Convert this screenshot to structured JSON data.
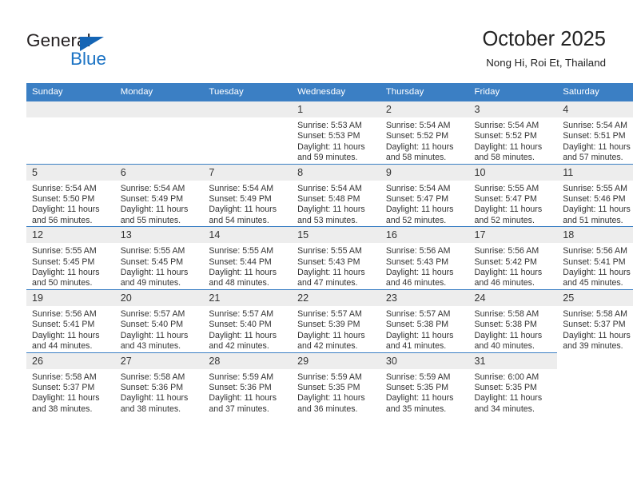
{
  "brand": {
    "name_dark": "General",
    "name_blue": "Blue",
    "triangle_color": "#1565b5",
    "blue_color": "#1b73c4"
  },
  "header": {
    "title": "October 2025",
    "subtitle": "Nong Hi, Roi Et, Thailand"
  },
  "theme": {
    "header_blue": "#3b7fc4",
    "daynum_bg": "#ededed",
    "text": "#333333"
  },
  "calendar": {
    "weekday_headers": [
      "Sunday",
      "Monday",
      "Tuesday",
      "Wednesday",
      "Thursday",
      "Friday",
      "Saturday"
    ],
    "weeks": [
      [
        {
          "day": "",
          "lines": []
        },
        {
          "day": "",
          "lines": []
        },
        {
          "day": "",
          "lines": []
        },
        {
          "day": "1",
          "lines": [
            "Sunrise: 5:53 AM",
            "Sunset: 5:53 PM",
            "Daylight: 11 hours and 59 minutes."
          ]
        },
        {
          "day": "2",
          "lines": [
            "Sunrise: 5:54 AM",
            "Sunset: 5:52 PM",
            "Daylight: 11 hours and 58 minutes."
          ]
        },
        {
          "day": "3",
          "lines": [
            "Sunrise: 5:54 AM",
            "Sunset: 5:52 PM",
            "Daylight: 11 hours and 58 minutes."
          ]
        },
        {
          "day": "4",
          "lines": [
            "Sunrise: 5:54 AM",
            "Sunset: 5:51 PM",
            "Daylight: 11 hours and 57 minutes."
          ]
        }
      ],
      [
        {
          "day": "5",
          "lines": [
            "Sunrise: 5:54 AM",
            "Sunset: 5:50 PM",
            "Daylight: 11 hours and 56 minutes."
          ]
        },
        {
          "day": "6",
          "lines": [
            "Sunrise: 5:54 AM",
            "Sunset: 5:49 PM",
            "Daylight: 11 hours and 55 minutes."
          ]
        },
        {
          "day": "7",
          "lines": [
            "Sunrise: 5:54 AM",
            "Sunset: 5:49 PM",
            "Daylight: 11 hours and 54 minutes."
          ]
        },
        {
          "day": "8",
          "lines": [
            "Sunrise: 5:54 AM",
            "Sunset: 5:48 PM",
            "Daylight: 11 hours and 53 minutes."
          ]
        },
        {
          "day": "9",
          "lines": [
            "Sunrise: 5:54 AM",
            "Sunset: 5:47 PM",
            "Daylight: 11 hours and 52 minutes."
          ]
        },
        {
          "day": "10",
          "lines": [
            "Sunrise: 5:55 AM",
            "Sunset: 5:47 PM",
            "Daylight: 11 hours and 52 minutes."
          ]
        },
        {
          "day": "11",
          "lines": [
            "Sunrise: 5:55 AM",
            "Sunset: 5:46 PM",
            "Daylight: 11 hours and 51 minutes."
          ]
        }
      ],
      [
        {
          "day": "12",
          "lines": [
            "Sunrise: 5:55 AM",
            "Sunset: 5:45 PM",
            "Daylight: 11 hours and 50 minutes."
          ]
        },
        {
          "day": "13",
          "lines": [
            "Sunrise: 5:55 AM",
            "Sunset: 5:45 PM",
            "Daylight: 11 hours and 49 minutes."
          ]
        },
        {
          "day": "14",
          "lines": [
            "Sunrise: 5:55 AM",
            "Sunset: 5:44 PM",
            "Daylight: 11 hours and 48 minutes."
          ]
        },
        {
          "day": "15",
          "lines": [
            "Sunrise: 5:55 AM",
            "Sunset: 5:43 PM",
            "Daylight: 11 hours and 47 minutes."
          ]
        },
        {
          "day": "16",
          "lines": [
            "Sunrise: 5:56 AM",
            "Sunset: 5:43 PM",
            "Daylight: 11 hours and 46 minutes."
          ]
        },
        {
          "day": "17",
          "lines": [
            "Sunrise: 5:56 AM",
            "Sunset: 5:42 PM",
            "Daylight: 11 hours and 46 minutes."
          ]
        },
        {
          "day": "18",
          "lines": [
            "Sunrise: 5:56 AM",
            "Sunset: 5:41 PM",
            "Daylight: 11 hours and 45 minutes."
          ]
        }
      ],
      [
        {
          "day": "19",
          "lines": [
            "Sunrise: 5:56 AM",
            "Sunset: 5:41 PM",
            "Daylight: 11 hours and 44 minutes."
          ]
        },
        {
          "day": "20",
          "lines": [
            "Sunrise: 5:57 AM",
            "Sunset: 5:40 PM",
            "Daylight: 11 hours and 43 minutes."
          ]
        },
        {
          "day": "21",
          "lines": [
            "Sunrise: 5:57 AM",
            "Sunset: 5:40 PM",
            "Daylight: 11 hours and 42 minutes."
          ]
        },
        {
          "day": "22",
          "lines": [
            "Sunrise: 5:57 AM",
            "Sunset: 5:39 PM",
            "Daylight: 11 hours and 42 minutes."
          ]
        },
        {
          "day": "23",
          "lines": [
            "Sunrise: 5:57 AM",
            "Sunset: 5:38 PM",
            "Daylight: 11 hours and 41 minutes."
          ]
        },
        {
          "day": "24",
          "lines": [
            "Sunrise: 5:58 AM",
            "Sunset: 5:38 PM",
            "Daylight: 11 hours and 40 minutes."
          ]
        },
        {
          "day": "25",
          "lines": [
            "Sunrise: 5:58 AM",
            "Sunset: 5:37 PM",
            "Daylight: 11 hours and 39 minutes."
          ]
        }
      ],
      [
        {
          "day": "26",
          "lines": [
            "Sunrise: 5:58 AM",
            "Sunset: 5:37 PM",
            "Daylight: 11 hours and 38 minutes."
          ]
        },
        {
          "day": "27",
          "lines": [
            "Sunrise: 5:58 AM",
            "Sunset: 5:36 PM",
            "Daylight: 11 hours and 38 minutes."
          ]
        },
        {
          "day": "28",
          "lines": [
            "Sunrise: 5:59 AM",
            "Sunset: 5:36 PM",
            "Daylight: 11 hours and 37 minutes."
          ]
        },
        {
          "day": "29",
          "lines": [
            "Sunrise: 5:59 AM",
            "Sunset: 5:35 PM",
            "Daylight: 11 hours and 36 minutes."
          ]
        },
        {
          "day": "30",
          "lines": [
            "Sunrise: 5:59 AM",
            "Sunset: 5:35 PM",
            "Daylight: 11 hours and 35 minutes."
          ]
        },
        {
          "day": "31",
          "lines": [
            "Sunrise: 6:00 AM",
            "Sunset: 5:35 PM",
            "Daylight: 11 hours and 34 minutes."
          ]
        }
      ]
    ]
  }
}
